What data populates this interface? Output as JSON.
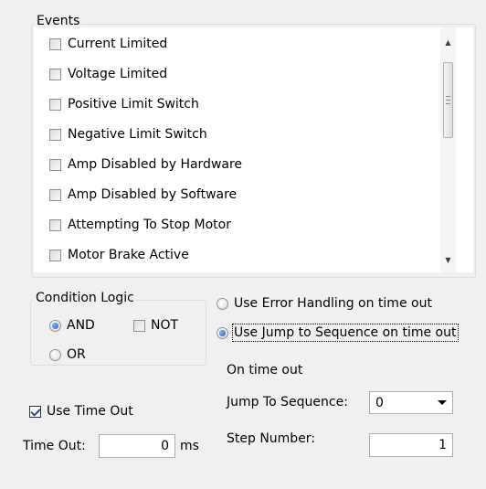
{
  "events": {
    "title": "Events",
    "items": [
      {
        "label": "Current Limited",
        "checked": false
      },
      {
        "label": "Voltage Limited",
        "checked": false
      },
      {
        "label": "Positive Limit Switch",
        "checked": false
      },
      {
        "label": "Negative Limit Switch",
        "checked": false
      },
      {
        "label": "Amp Disabled by Hardware",
        "checked": false
      },
      {
        "label": "Amp Disabled by Software",
        "checked": false
      },
      {
        "label": "Attempting To Stop Motor",
        "checked": false
      },
      {
        "label": "Motor Brake Active",
        "checked": false
      }
    ],
    "scroll_up_icon": "triangle-up-icon",
    "scroll_down_icon": "triangle-down-icon"
  },
  "condition_logic": {
    "title": "Condition Logic",
    "and_label": "AND",
    "and_selected": true,
    "not_label": "NOT",
    "not_checked": false,
    "or_label": "OR",
    "or_selected": false
  },
  "timeout": {
    "use_label": "Use Time Out",
    "use_checked": true,
    "label": "Time Out:",
    "value": "0",
    "unit": "ms"
  },
  "timeout_action": {
    "error_label": "Use Error Handling on time out",
    "error_selected": false,
    "jump_label": "Use Jump to Sequence on time out",
    "jump_selected": true,
    "section_label": "On time out",
    "jump_seq_label": "Jump To Sequence:",
    "jump_seq_value": "0",
    "step_label": "Step Number:",
    "step_value": "1"
  }
}
